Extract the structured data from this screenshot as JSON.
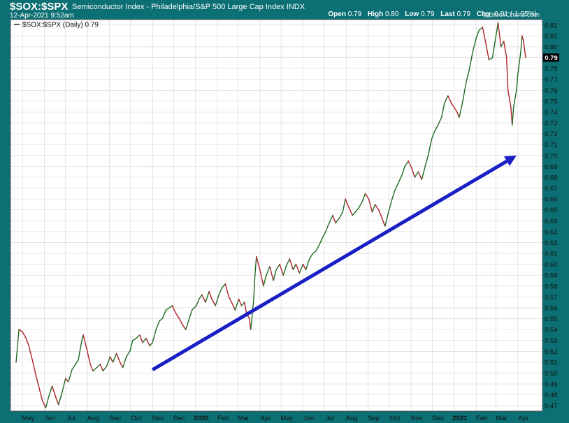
{
  "header": {
    "symbol": "$SOX:$SPX",
    "description": "Semiconductor Index - Philadelphia/S&P 500 Large Cap Index",
    "exchange": "INDX",
    "datetime": "12-Apr-2021 9:52am",
    "watermark": "@StockCharts.com",
    "ohlc": [
      {
        "label": "Open",
        "value": "0.79"
      },
      {
        "label": "High",
        "value": "0.80"
      },
      {
        "label": "Low",
        "value": "0.79"
      },
      {
        "label": "Last",
        "value": "0.79"
      },
      {
        "label": "Chg",
        "value": "-0.01 (-1.05%)"
      }
    ]
  },
  "colors": {
    "frame": "#0c6f73",
    "up": "#1f6b1f",
    "down": "#b0202a",
    "arrow": "#1a1fc4",
    "grid": "#d4d4d4",
    "current_value_box": "#000000"
  },
  "chart_data": {
    "type": "line",
    "legend": "$SOX:$SPX (Daily) 0.79",
    "legend_position": "top-left",
    "current_value": "0.79",
    "grid": true,
    "ylim": [
      0.465,
      0.825
    ],
    "y_ticks": [
      0.47,
      0.48,
      0.49,
      0.5,
      0.51,
      0.52,
      0.53,
      0.54,
      0.55,
      0.56,
      0.57,
      0.58,
      0.59,
      0.6,
      0.61,
      0.62,
      0.63,
      0.64,
      0.65,
      0.66,
      0.67,
      0.68,
      0.69,
      0.7,
      0.71,
      0.72,
      0.73,
      0.74,
      0.75,
      0.76,
      0.77,
      0.78,
      0.79,
      0.8,
      0.81,
      0.82
    ],
    "x_ticks": [
      "May",
      "Jun",
      "Jul",
      "Aug",
      "Sep",
      "Oct",
      "Nov",
      "Dec",
      "2020",
      "Feb",
      "Mar",
      "Apr",
      "May",
      "Jun",
      "Jul",
      "Aug",
      "Sep",
      "Oct",
      "Nov",
      "Dec",
      "2021",
      "Feb",
      "Mar",
      "Apr"
    ],
    "x_range": [
      "2019-04-20",
      "2021-04-12"
    ],
    "series": [
      {
        "values": [
          [
            "2019-04-22",
            0.51
          ],
          [
            "2019-04-26",
            0.54
          ],
          [
            "2019-05-01",
            0.538
          ],
          [
            "2019-05-06",
            0.532
          ],
          [
            "2019-05-10",
            0.525
          ],
          [
            "2019-05-15",
            0.512
          ],
          [
            "2019-05-20",
            0.498
          ],
          [
            "2019-05-24",
            0.488
          ],
          [
            "2019-05-29",
            0.475
          ],
          [
            "2019-06-03",
            0.468
          ],
          [
            "2019-06-07",
            0.478
          ],
          [
            "2019-06-12",
            0.488
          ],
          [
            "2019-06-17",
            0.478
          ],
          [
            "2019-06-21",
            0.471
          ],
          [
            "2019-06-26",
            0.482
          ],
          [
            "2019-07-01",
            0.495
          ],
          [
            "2019-07-05",
            0.492
          ],
          [
            "2019-07-10",
            0.503
          ],
          [
            "2019-07-15",
            0.508
          ],
          [
            "2019-07-19",
            0.512
          ],
          [
            "2019-07-24",
            0.53
          ],
          [
            "2019-07-26",
            0.535
          ],
          [
            "2019-07-31",
            0.522
          ],
          [
            "2019-08-05",
            0.508
          ],
          [
            "2019-08-09",
            0.502
          ],
          [
            "2019-08-14",
            0.505
          ],
          [
            "2019-08-19",
            0.508
          ],
          [
            "2019-08-23",
            0.502
          ],
          [
            "2019-08-28",
            0.506
          ],
          [
            "2019-09-02",
            0.515
          ],
          [
            "2019-09-06",
            0.51
          ],
          [
            "2019-09-11",
            0.518
          ],
          [
            "2019-09-16",
            0.51
          ],
          [
            "2019-09-20",
            0.505
          ],
          [
            "2019-09-25",
            0.515
          ],
          [
            "2019-09-30",
            0.52
          ],
          [
            "2019-10-04",
            0.53
          ],
          [
            "2019-10-09",
            0.532
          ],
          [
            "2019-10-14",
            0.535
          ],
          [
            "2019-10-18",
            0.528
          ],
          [
            "2019-10-23",
            0.532
          ],
          [
            "2019-10-28",
            0.525
          ],
          [
            "2019-11-01",
            0.528
          ],
          [
            "2019-11-06",
            0.54
          ],
          [
            "2019-11-11",
            0.548
          ],
          [
            "2019-11-15",
            0.55
          ],
          [
            "2019-11-20",
            0.558
          ],
          [
            "2019-11-25",
            0.56
          ],
          [
            "2019-11-29",
            0.562
          ],
          [
            "2019-12-04",
            0.555
          ],
          [
            "2019-12-09",
            0.55
          ],
          [
            "2019-12-13",
            0.545
          ],
          [
            "2019-12-18",
            0.54
          ],
          [
            "2019-12-23",
            0.55
          ],
          [
            "2019-12-27",
            0.558
          ],
          [
            "2020-01-02",
            0.562
          ],
          [
            "2020-01-06",
            0.568
          ],
          [
            "2020-01-10",
            0.572
          ],
          [
            "2020-01-15",
            0.565
          ],
          [
            "2020-01-20",
            0.575
          ],
          [
            "2020-01-24",
            0.568
          ],
          [
            "2020-01-29",
            0.562
          ],
          [
            "2020-02-03",
            0.572
          ],
          [
            "2020-02-07",
            0.578
          ],
          [
            "2020-02-12",
            0.582
          ],
          [
            "2020-02-17",
            0.57
          ],
          [
            "2020-02-21",
            0.565
          ],
          [
            "2020-02-26",
            0.558
          ],
          [
            "2020-03-02",
            0.568
          ],
          [
            "2020-03-06",
            0.562
          ],
          [
            "2020-03-10",
            0.565
          ],
          [
            "2020-03-13",
            0.555
          ],
          [
            "2020-03-17",
            0.55
          ],
          [
            "2020-03-19",
            0.54
          ],
          [
            "2020-03-23",
            0.566
          ],
          [
            "2020-03-25",
            0.59
          ],
          [
            "2020-03-27",
            0.607
          ],
          [
            "2020-04-01",
            0.595
          ],
          [
            "2020-04-06",
            0.58
          ],
          [
            "2020-04-10",
            0.59
          ],
          [
            "2020-04-15",
            0.598
          ],
          [
            "2020-04-20",
            0.585
          ],
          [
            "2020-04-24",
            0.595
          ],
          [
            "2020-04-29",
            0.6
          ],
          [
            "2020-05-04",
            0.59
          ],
          [
            "2020-05-08",
            0.598
          ],
          [
            "2020-05-13",
            0.605
          ],
          [
            "2020-05-18",
            0.595
          ],
          [
            "2020-05-22",
            0.6
          ],
          [
            "2020-05-27",
            0.592
          ],
          [
            "2020-06-01",
            0.6
          ],
          [
            "2020-06-05",
            0.595
          ],
          [
            "2020-06-10",
            0.605
          ],
          [
            "2020-06-15",
            0.61
          ],
          [
            "2020-06-19",
            0.612
          ],
          [
            "2020-06-24",
            0.618
          ],
          [
            "2020-06-29",
            0.625
          ],
          [
            "2020-07-03",
            0.63
          ],
          [
            "2020-07-08",
            0.638
          ],
          [
            "2020-07-13",
            0.645
          ],
          [
            "2020-07-17",
            0.638
          ],
          [
            "2020-07-22",
            0.642
          ],
          [
            "2020-07-27",
            0.648
          ],
          [
            "2020-07-31",
            0.66
          ],
          [
            "2020-08-05",
            0.652
          ],
          [
            "2020-08-10",
            0.645
          ],
          [
            "2020-08-14",
            0.648
          ],
          [
            "2020-08-19",
            0.652
          ],
          [
            "2020-08-24",
            0.658
          ],
          [
            "2020-08-28",
            0.665
          ],
          [
            "2020-09-02",
            0.66
          ],
          [
            "2020-09-07",
            0.648
          ],
          [
            "2020-09-11",
            0.655
          ],
          [
            "2020-09-16",
            0.65
          ],
          [
            "2020-09-21",
            0.642
          ],
          [
            "2020-09-25",
            0.635
          ],
          [
            "2020-09-30",
            0.648
          ],
          [
            "2020-10-05",
            0.66
          ],
          [
            "2020-10-09",
            0.668
          ],
          [
            "2020-10-14",
            0.675
          ],
          [
            "2020-10-19",
            0.682
          ],
          [
            "2020-10-23",
            0.69
          ],
          [
            "2020-10-28",
            0.695
          ],
          [
            "2020-11-02",
            0.688
          ],
          [
            "2020-11-06",
            0.68
          ],
          [
            "2020-11-11",
            0.685
          ],
          [
            "2020-11-16",
            0.678
          ],
          [
            "2020-11-20",
            0.688
          ],
          [
            "2020-11-25",
            0.7
          ],
          [
            "2020-11-30",
            0.715
          ],
          [
            "2020-12-04",
            0.722
          ],
          [
            "2020-12-09",
            0.728
          ],
          [
            "2020-12-14",
            0.735
          ],
          [
            "2020-12-18",
            0.748
          ],
          [
            "2020-12-23",
            0.755
          ],
          [
            "2020-12-28",
            0.748
          ],
          [
            "2020-12-31",
            0.745
          ],
          [
            "2021-01-05",
            0.74
          ],
          [
            "2021-01-08",
            0.735
          ],
          [
            "2021-01-13",
            0.75
          ],
          [
            "2021-01-18",
            0.768
          ],
          [
            "2021-01-22",
            0.778
          ],
          [
            "2021-01-27",
            0.795
          ],
          [
            "2021-02-01",
            0.808
          ],
          [
            "2021-02-05",
            0.815
          ],
          [
            "2021-02-10",
            0.818
          ],
          [
            "2021-02-15",
            0.802
          ],
          [
            "2021-02-19",
            0.788
          ],
          [
            "2021-02-24",
            0.79
          ],
          [
            "2021-03-01",
            0.81
          ],
          [
            "2021-03-04",
            0.822
          ],
          [
            "2021-03-08",
            0.8
          ],
          [
            "2021-03-12",
            0.805
          ],
          [
            "2021-03-16",
            0.79
          ],
          [
            "2021-03-18",
            0.76
          ],
          [
            "2021-03-22",
            0.745
          ],
          [
            "2021-03-24",
            0.728
          ],
          [
            "2021-03-26",
            0.745
          ],
          [
            "2021-03-30",
            0.76
          ],
          [
            "2021-04-01",
            0.775
          ],
          [
            "2021-04-05",
            0.795
          ],
          [
            "2021-04-07",
            0.81
          ],
          [
            "2021-04-09",
            0.805
          ],
          [
            "2021-04-12",
            0.79
          ]
        ]
      }
    ],
    "annotations": [
      {
        "type": "arrow",
        "from": [
          "2019-11-01",
          0.503
        ],
        "to": [
          "2021-03-30",
          0.7
        ]
      }
    ]
  }
}
